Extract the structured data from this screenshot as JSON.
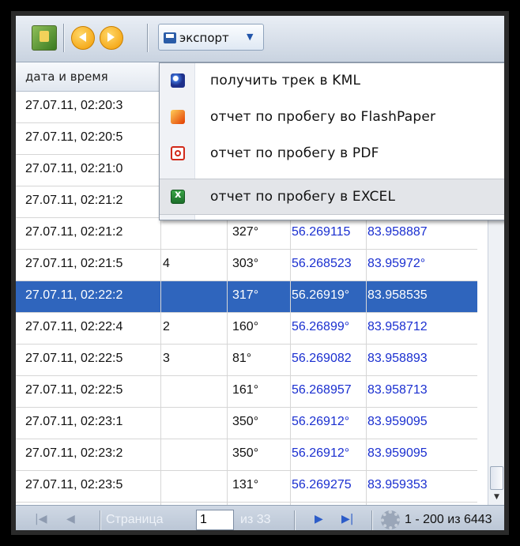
{
  "toolbar": {
    "export_label": "экспорт"
  },
  "grid": {
    "header": "дата и время",
    "rows": [
      {
        "time": "27.07.11, 02:20:3",
        "n": "",
        "course": "",
        "lat": "",
        "lon": ""
      },
      {
        "time": "27.07.11, 02:20:5",
        "n": "",
        "course": "",
        "lat": "",
        "lon": ""
      },
      {
        "time": "27.07.11, 02:21:0",
        "n": "",
        "course": "",
        "lat": "",
        "lon": ""
      },
      {
        "time": "27.07.11, 02:21:2",
        "n": "",
        "course": "",
        "lat": "",
        "lon": ""
      },
      {
        "time": "27.07.11, 02:21:2",
        "n": "",
        "course": "327°",
        "lat": "56.269115",
        "lon": "83.958887"
      },
      {
        "time": "27.07.11, 02:21:5",
        "n": "4",
        "course": "303°",
        "lat": "56.268523",
        "lon": "83.95972°"
      },
      {
        "time": "27.07.11, 02:22:2",
        "n": "",
        "course": "317°",
        "lat": "56.26919°",
        "lon": "83.958535"
      },
      {
        "time": "27.07.11, 02:22:4",
        "n": "2",
        "course": "160°",
        "lat": "56.26899°",
        "lon": "83.958712"
      },
      {
        "time": "27.07.11, 02:22:5",
        "n": "3",
        "course": "81°",
        "lat": "56.269082",
        "lon": "83.958893"
      },
      {
        "time": "27.07.11, 02:22:5",
        "n": "",
        "course": "161°",
        "lat": "56.268957",
        "lon": "83.958713"
      },
      {
        "time": "27.07.11, 02:23:1",
        "n": "",
        "course": "350°",
        "lat": "56.26912°",
        "lon": "83.959095"
      },
      {
        "time": "27.07.11, 02:23:2",
        "n": "",
        "course": "350°",
        "lat": "56.26912°",
        "lon": "83.959095"
      },
      {
        "time": "27.07.11, 02:23:5",
        "n": "",
        "course": "131°",
        "lat": "56.269275",
        "lon": "83.959353"
      }
    ],
    "selected_index": 6
  },
  "menu": {
    "items": [
      {
        "label": "получить трек в KML",
        "icon": "google-earth-icon"
      },
      {
        "label": "отчет по пробегу во FlashPaper",
        "icon": "flashpaper-icon"
      },
      {
        "label": "отчет по пробегу в PDF",
        "icon": "pdf-icon"
      },
      {
        "label": "отчет по пробегу в EXCEL",
        "icon": "excel-icon"
      }
    ],
    "highlighted_index": 3
  },
  "pager": {
    "page_label": "Страница",
    "page_value": "1",
    "of_label": "из 33",
    "count_text": "1 - 200 из 6443"
  }
}
